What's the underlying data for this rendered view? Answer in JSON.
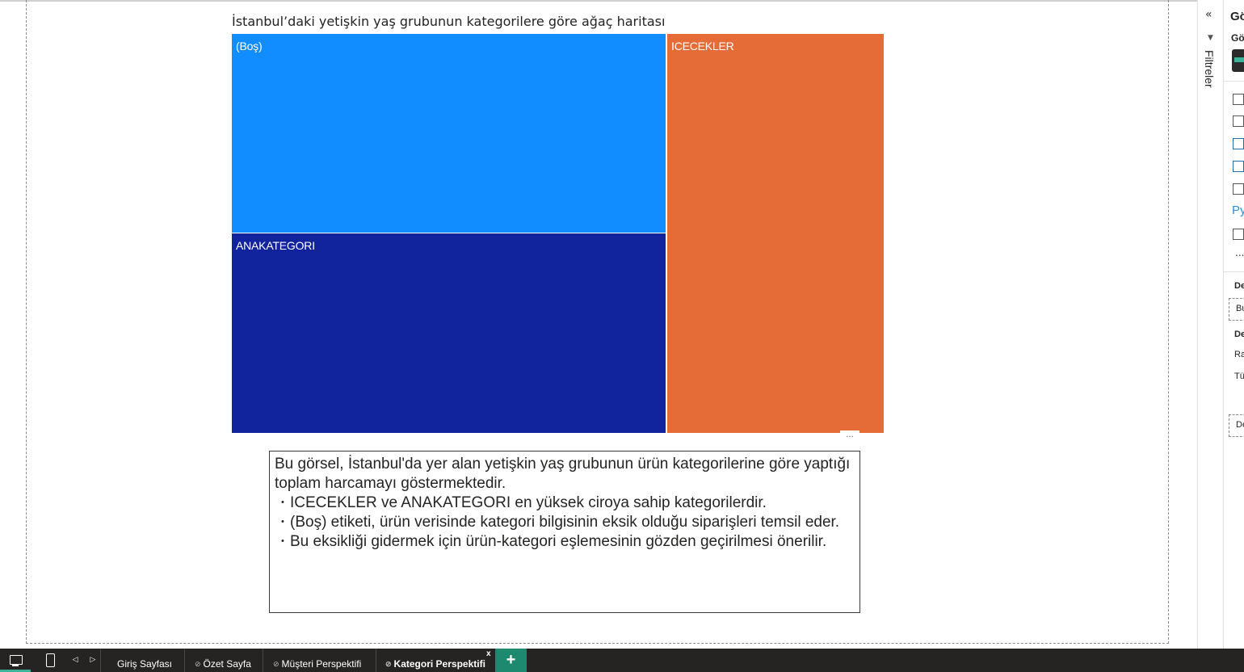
{
  "visual": {
    "title": "İstanbul’daki yetişkin yaş grubunun kategorilere göre ağaç haritası",
    "more_options": "···"
  },
  "chart_data": {
    "type": "treemap",
    "title": "İstanbul’daki yetişkin yaş grubunun kategorilere göre ağaç haritası",
    "tiles": [
      {
        "label": "(Boş)",
        "color": "#118dff"
      },
      {
        "label": "ANAKATEGORI",
        "color": "#12239e"
      },
      {
        "label": "ICECEKLER",
        "color": "#e66c37"
      }
    ]
  },
  "textbox": {
    "intro": "Bu görsel, İstanbul'da yer alan yetişkin yaş grubunun ürün kategorilerine göre yaptığı toplam harcamayı göstermektedir.",
    "bullets": [
      "ICECEKLER ve ANAKATEGORI en yüksek ciroya sahip kategorilerdir.",
      "(Boş) etiketi, ürün verisinde kategori bilgisinin eksik olduğu siparişleri temsil eder.",
      " Bu eksikliği gidermek için ürün-kategori eşlemesinin gözden geçirilmesi önerilir."
    ]
  },
  "filters_pane": {
    "collapse": "«",
    "label": "Filtreler"
  },
  "viz_pane": {
    "title": "Gö",
    "subtitle": "Gö",
    "python_label": "Py",
    "more": "...",
    "lines": [
      "De",
      "Bu",
      "De",
      "Ra",
      "Tü",
      "De"
    ]
  },
  "bottom_bar": {
    "prev": "◁",
    "next": "▷",
    "tabs": [
      {
        "label": "Giriş Sayfası",
        "hidden": false,
        "active": false
      },
      {
        "label": "Özet Sayfa",
        "hidden": true,
        "active": false
      },
      {
        "label": "Müşteri Perspektifi",
        "hidden": true,
        "active": false
      },
      {
        "label": "Kategori Perspektifi",
        "hidden": true,
        "active": true
      }
    ],
    "close": "x",
    "add": "+"
  },
  "colors": {
    "accent": "#3bb39a",
    "add_page": "#1d8a6f",
    "bar_background": "#252423"
  }
}
